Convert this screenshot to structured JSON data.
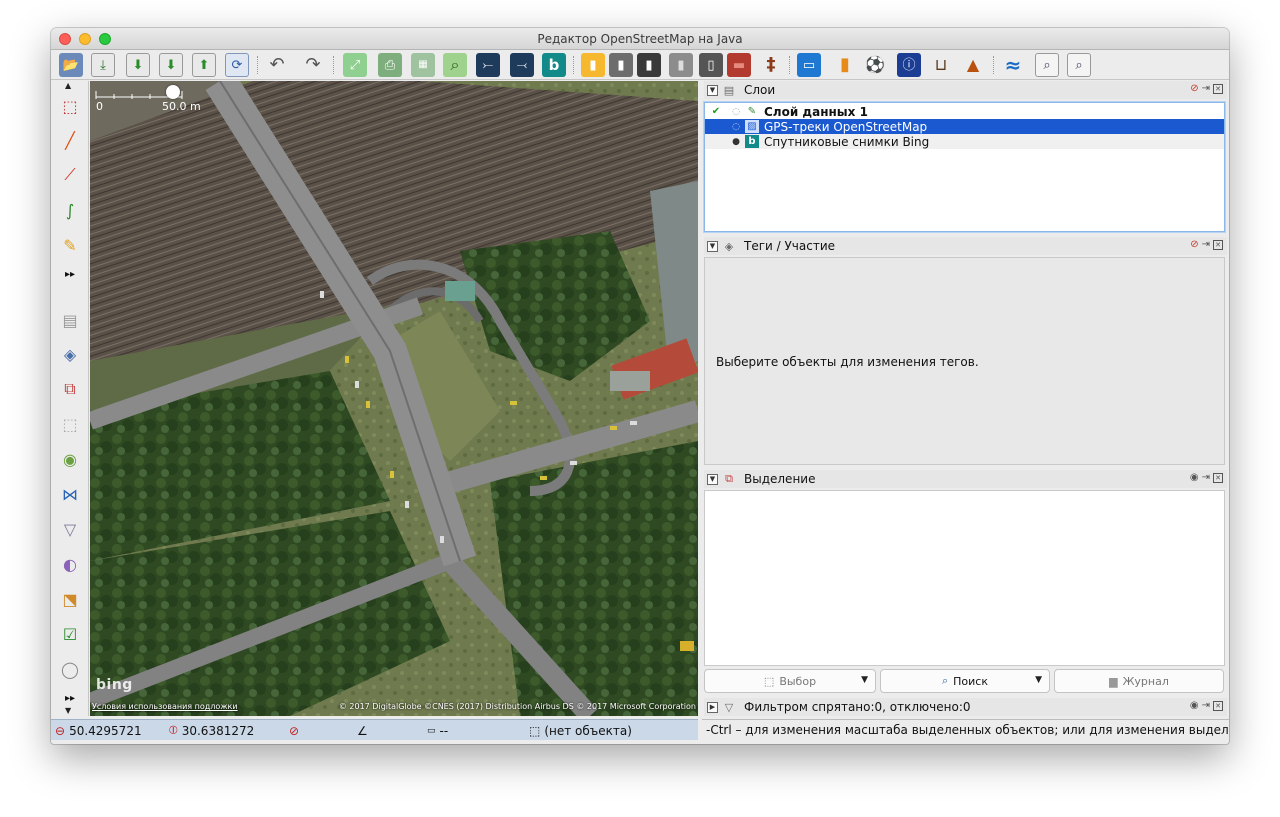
{
  "window": {
    "title": "Редактор OpenStreetMap на Java"
  },
  "toolbar": {
    "buttons": [
      {
        "name": "open-file",
        "icon": "folder-open-icon",
        "glyph": "📂"
      },
      {
        "name": "open-location",
        "icon": "globe-download-icon",
        "glyph": "⤓"
      },
      {
        "name": "download",
        "icon": "download-icon",
        "glyph": "⬇"
      },
      {
        "name": "download-in-view",
        "icon": "download-view-icon",
        "glyph": "⬇"
      },
      {
        "name": "upload",
        "icon": "upload-icon",
        "glyph": "⬆"
      },
      {
        "name": "update-data",
        "icon": "refresh-globe-icon",
        "glyph": "⟳"
      },
      {
        "name": "undo",
        "icon": "undo-icon",
        "glyph": "↶"
      },
      {
        "name": "redo",
        "icon": "redo-icon",
        "glyph": "↷"
      },
      {
        "name": "zoom-to-data",
        "icon": "zoom-data-icon",
        "glyph": "⤢"
      },
      {
        "name": "print",
        "icon": "print-icon",
        "glyph": "⎙"
      },
      {
        "name": "wms",
        "icon": "wms-icon",
        "glyph": "▦"
      },
      {
        "name": "search",
        "icon": "magnifier-icon",
        "glyph": "⌕"
      },
      {
        "name": "conflict-1",
        "icon": "road-split-icon",
        "glyph": "⤚"
      },
      {
        "name": "conflict-2",
        "icon": "road-join-icon",
        "glyph": "⤙"
      },
      {
        "name": "bing",
        "icon": "bing-icon",
        "glyph": "b"
      },
      {
        "name": "road-1",
        "icon": "road-yellow-icon",
        "glyph": "▮"
      },
      {
        "name": "road-2",
        "icon": "road-grey-icon",
        "glyph": "▮"
      },
      {
        "name": "road-3",
        "icon": "road-dark-icon",
        "glyph": "▮"
      },
      {
        "name": "road-4",
        "icon": "road-light-icon",
        "glyph": "▮"
      },
      {
        "name": "traffic-light",
        "icon": "traffic-light-icon",
        "glyph": "▯"
      },
      {
        "name": "building",
        "icon": "brick-wall-icon",
        "glyph": "▬"
      },
      {
        "name": "railway",
        "icon": "railway-icon",
        "glyph": "‡"
      },
      {
        "name": "hotel",
        "icon": "bed-icon",
        "glyph": "▭"
      },
      {
        "name": "shop",
        "icon": "shopping-bag-icon",
        "glyph": "▮"
      },
      {
        "name": "sport",
        "icon": "football-icon",
        "glyph": "⚽"
      },
      {
        "name": "poi",
        "icon": "info-sign-icon",
        "glyph": "ⓘ"
      },
      {
        "name": "industrial",
        "icon": "factory-icon",
        "glyph": "⊔"
      },
      {
        "name": "peak",
        "icon": "mountain-icon",
        "glyph": "▲"
      },
      {
        "name": "waterway",
        "icon": "waterway-icon",
        "glyph": "≈"
      },
      {
        "name": "zoom-in-map",
        "icon": "zoom-in-page-icon",
        "glyph": "⌕"
      },
      {
        "name": "zoom-out-map",
        "icon": "zoom-out-page-icon",
        "glyph": "⌕"
      }
    ]
  },
  "left_tools": [
    {
      "icon": "select-tool-icon",
      "glyph": "⬚"
    },
    {
      "icon": "draw-line-icon",
      "glyph": "╱"
    },
    {
      "icon": "draw-polyline-icon",
      "glyph": "⟋"
    },
    {
      "icon": "improve-way-icon",
      "glyph": "∫"
    },
    {
      "icon": "pencil-icon",
      "glyph": "✎"
    },
    {
      "icon": "more-tools-icon",
      "glyph": "▸▸"
    },
    {
      "icon": "layers-panel-icon",
      "glyph": "▤"
    },
    {
      "icon": "tags-panel-icon",
      "glyph": "◈"
    },
    {
      "icon": "relation-panel-icon",
      "glyph": "⧉"
    },
    {
      "icon": "selection-panel-icon",
      "glyph": "⬚"
    },
    {
      "icon": "user-panel-icon",
      "glyph": "◉"
    },
    {
      "icon": "conflict-panel-icon",
      "glyph": "⋈"
    },
    {
      "icon": "filter-panel-icon",
      "glyph": "▽"
    },
    {
      "icon": "style-panel-icon",
      "glyph": "◐"
    },
    {
      "icon": "validator-panel-icon",
      "glyph": "⬔"
    },
    {
      "icon": "todo-panel-icon",
      "glyph": "☑"
    },
    {
      "icon": "history-globe-icon",
      "glyph": "◯"
    },
    {
      "icon": "more-panels-icon",
      "glyph": "▸▸"
    }
  ],
  "map": {
    "scale_zero": "0",
    "scale_distance": "50.0 m",
    "bing_logo": "bing",
    "terms_link": "Условия использования подложки",
    "attribution": "© 2017 DigitalGlobe ©CNES (2017) Distribution Airbus DS © 2017 Microsoft Corporation"
  },
  "layers": {
    "title": "Слои",
    "items": [
      {
        "name": "Слой данных 1",
        "active": true,
        "visible": false,
        "selected": false,
        "icon": "data-layer-icon"
      },
      {
        "name": "GPS-треки OpenStreetMap",
        "active": false,
        "visible": false,
        "selected": true,
        "icon": "gps-layer-icon"
      },
      {
        "name": "Спутниковые снимки Bing",
        "active": false,
        "visible": true,
        "selected": false,
        "icon": "bing-layer-icon"
      }
    ]
  },
  "tags": {
    "title": "Теги / Участие",
    "empty_message": "Выберите объекты для изменения тегов."
  },
  "selection": {
    "title": "Выделение",
    "buttons": [
      {
        "label": "Выбор",
        "icon": "select-cursor-icon",
        "enabled": false
      },
      {
        "label": "Поиск",
        "icon": "search-icon",
        "enabled": true
      },
      {
        "label": "Журнал",
        "icon": "history-icon",
        "enabled": false
      }
    ]
  },
  "filter": {
    "title": "Фильтром спрятано:0, отключено:0"
  },
  "status": {
    "lat": "50.4295721",
    "lon": "30.6381272",
    "heading": "",
    "angle": "",
    "distance": "--",
    "object": "(нет объекта)",
    "help": "-Ctrl – для изменения масштаба выделенных объектов; или для изменения выделения"
  },
  "colors": {
    "selection_blue": "#1b59d1",
    "status_bg": "#cad8e8",
    "window_bg": "#ececec"
  }
}
